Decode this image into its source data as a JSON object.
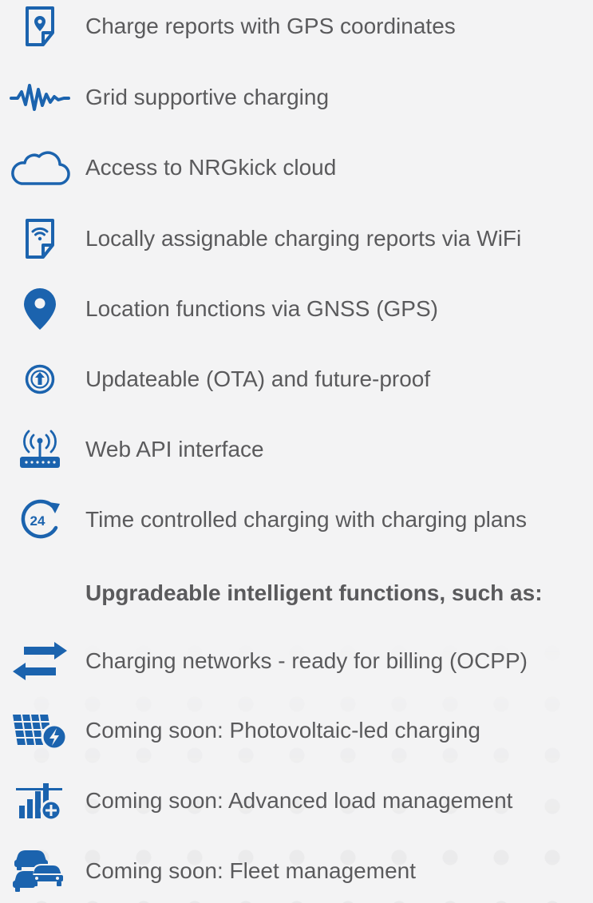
{
  "accent_color": "#1b63ae",
  "features": [
    {
      "icon": "gps-report-icon",
      "label": "Charge reports with GPS coordinates"
    },
    {
      "icon": "grid-wave-icon",
      "label": "Grid supportive charging"
    },
    {
      "icon": "cloud-icon",
      "label": "Access to NRGkick cloud"
    },
    {
      "icon": "wifi-report-icon",
      "label": "Locally assignable charging reports via WiFi"
    },
    {
      "icon": "location-pin-icon",
      "label": "Location functions via GNSS (GPS)"
    },
    {
      "icon": "update-arrow-icon",
      "label": "Updateable (OTA) and future-proof"
    },
    {
      "icon": "router-antenna-icon",
      "label": "Web API interface"
    },
    {
      "icon": "clock-24-icon",
      "label": "Time controlled charging with charging plans"
    }
  ],
  "upgradeable_heading": "Upgradeable intelligent functions, such as:",
  "upgradeable": [
    {
      "icon": "swap-arrows-icon",
      "label": "Charging networks - ready for billing (OCPP)"
    },
    {
      "icon": "solar-panel-icon",
      "label": "Coming soon: Photovoltaic-led charging"
    },
    {
      "icon": "load-bars-icon",
      "label": "Coming soon: Advanced load management"
    },
    {
      "icon": "fleet-cars-icon",
      "label": "Coming soon: Fleet management"
    }
  ],
  "clock_icon_text": "24"
}
